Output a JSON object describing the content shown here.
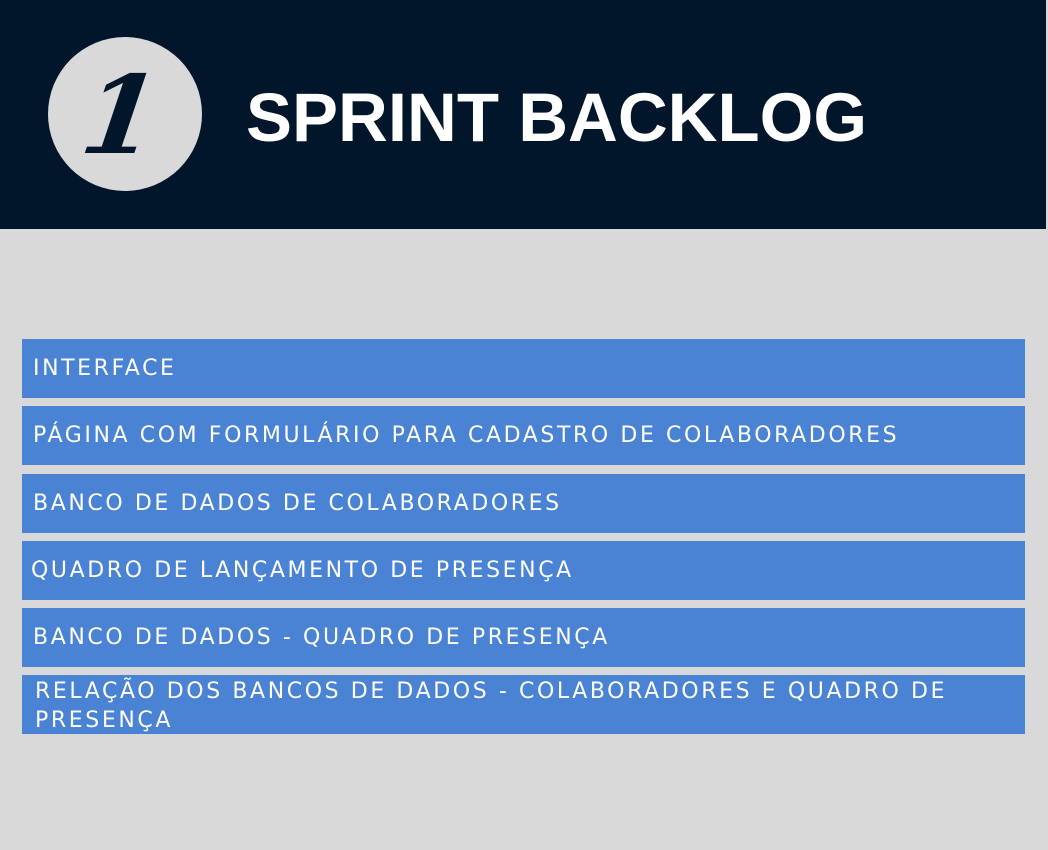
{
  "header": {
    "number": "1",
    "title": "SPRINT BACKLOG"
  },
  "backlog": {
    "items": [
      {
        "label": "INTERFACE"
      },
      {
        "label": "PÁGINA COM FORMULÁRIO PARA CADASTRO DE COLABORADORES"
      },
      {
        "label": "BANCO DE DADOS DE COLABORADORES"
      },
      {
        "label": "QUADRO DE LANÇAMENTO DE PRESENÇA"
      },
      {
        "label": "BANCO DE DADOS - QUADRO DE PRESENÇA"
      },
      {
        "label": "RELAÇÃO DOS BANCOS DE DADOS - COLABORADORES E QUADRO DE PRESENÇA"
      }
    ]
  },
  "colors": {
    "header_bg": "#01162b",
    "page_bg": "#d9d9d9",
    "item_bg": "#4a82d4",
    "text_light": "#ffffff"
  }
}
